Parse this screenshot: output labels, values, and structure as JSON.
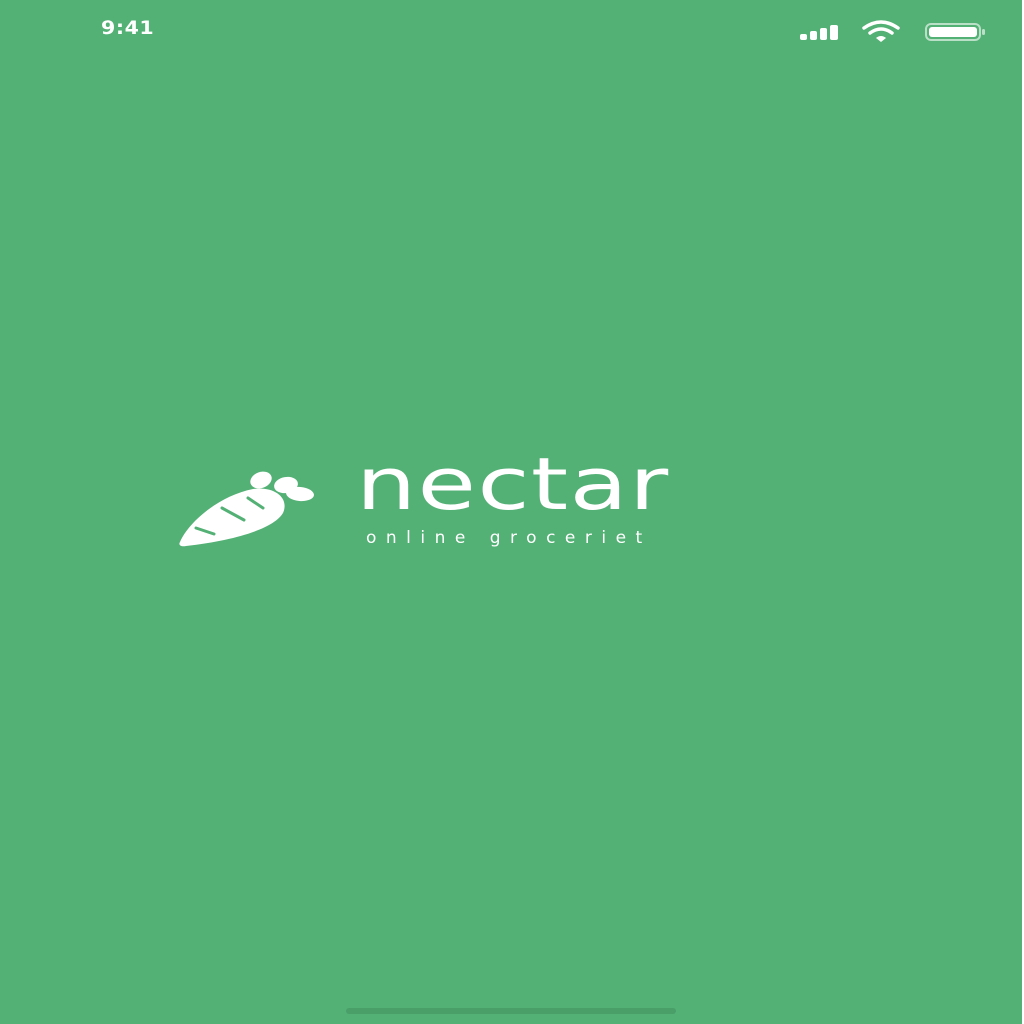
{
  "status_bar": {
    "time": "9:41",
    "icons": [
      "signal-icon",
      "wifi-icon",
      "battery-icon"
    ]
  },
  "logo": {
    "icon": "carrot-icon",
    "name": "nectar",
    "tagline": "online groceriet"
  },
  "colors": {
    "background": "#53b175",
    "foreground": "#ffffff",
    "home_indicator": "#4a9f69"
  }
}
